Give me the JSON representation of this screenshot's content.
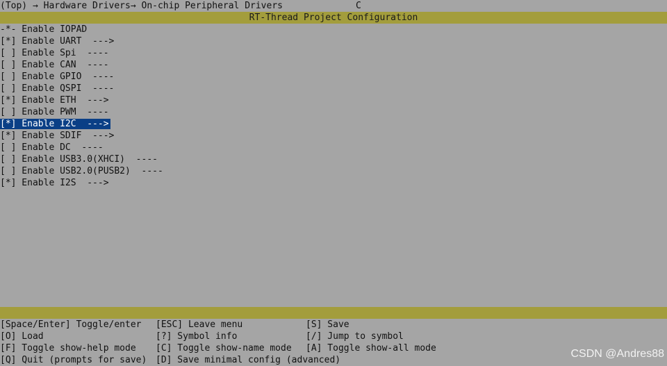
{
  "breadcrumb": {
    "path": "(Top) → Hardware Drivers→ On-chip Peripheral Drivers",
    "extra": "C"
  },
  "title": "RT-Thread Project Configuration",
  "menu": {
    "items": [
      {
        "text": "-*- Enable IOPAD",
        "selected": false
      },
      {
        "text": "[*] Enable UART  --->",
        "selected": false
      },
      {
        "text": "[ ] Enable Spi  ----",
        "selected": false
      },
      {
        "text": "[ ] Enable CAN  ----",
        "selected": false
      },
      {
        "text": "[ ] Enable GPIO  ----",
        "selected": false
      },
      {
        "text": "[ ] Enable QSPI  ----",
        "selected": false
      },
      {
        "text": "[*] Enable ETH  --->",
        "selected": false
      },
      {
        "text": "[ ] Enable PWM  ----",
        "selected": false
      },
      {
        "text": "[*] Enable I2C  --->",
        "selected": true
      },
      {
        "text": "[*] Enable SDIF  --->",
        "selected": false
      },
      {
        "text": "[ ] Enable DC  ----",
        "selected": false
      },
      {
        "text": "[ ] Enable USB3.0(XHCI)  ----",
        "selected": false
      },
      {
        "text": "[ ] Enable USB2.0(PUSB2)  ----",
        "selected": false
      },
      {
        "text": "[*] Enable I2S  --->",
        "selected": false
      }
    ]
  },
  "help": {
    "rows": [
      [
        "[Space/Enter] Toggle/enter",
        "[ESC] Leave menu",
        "[S] Save"
      ],
      [
        "[O] Load",
        "[?] Symbol info",
        "[/] Jump to symbol"
      ],
      [
        "[F] Toggle show-help mode",
        "[C] Toggle show-name mode",
        "[A] Toggle show-all mode"
      ],
      [
        "[Q] Quit (prompts for save)",
        "[D] Save minimal config (advanced)",
        ""
      ]
    ]
  },
  "watermark": "CSDN @Andres88",
  "colors": {
    "background": "#a5a5a5",
    "title_bar": "#a39d3c",
    "selection": "#0a3f86"
  }
}
